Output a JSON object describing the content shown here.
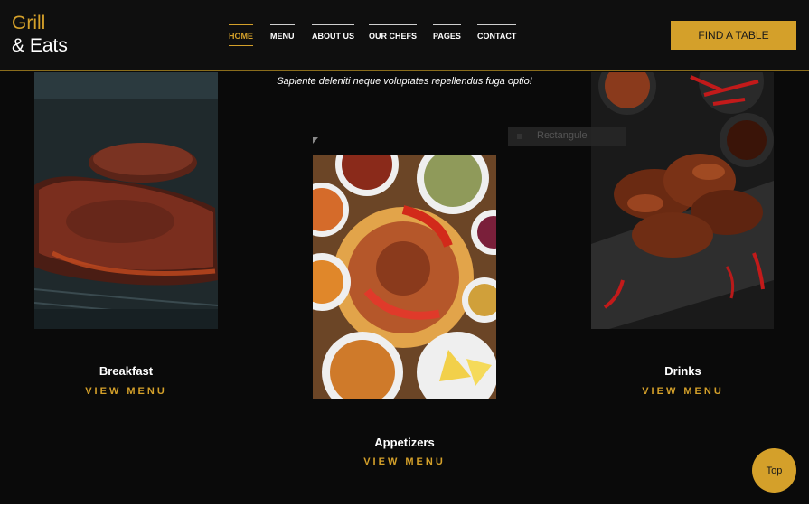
{
  "logo": {
    "line1": "Grill",
    "line2": "& Eats"
  },
  "nav": {
    "home": "HOME",
    "menu": "MENU",
    "about": "ABOUT US",
    "chefs": "OUR CHEFS",
    "pages": "PAGES",
    "contact": "CONTACT"
  },
  "cta": {
    "find_table": "FIND A TABLE"
  },
  "tagline": "Sapiente deleniti neque voluptates repellendus fuga optio!",
  "ghost_label": "Rectangule",
  "cards": {
    "breakfast": {
      "title": "Breakfast",
      "link": "VIEW MENU"
    },
    "appetizers": {
      "title": "Appetizers",
      "link": "VIEW MENU"
    },
    "drinks": {
      "title": "Drinks",
      "link": "VIEW MENU"
    }
  },
  "scroll_top": {
    "label": "Top"
  },
  "colors": {
    "accent": "#d4a02a",
    "background": "#0a0a0a",
    "header": "#0f0f0f"
  }
}
